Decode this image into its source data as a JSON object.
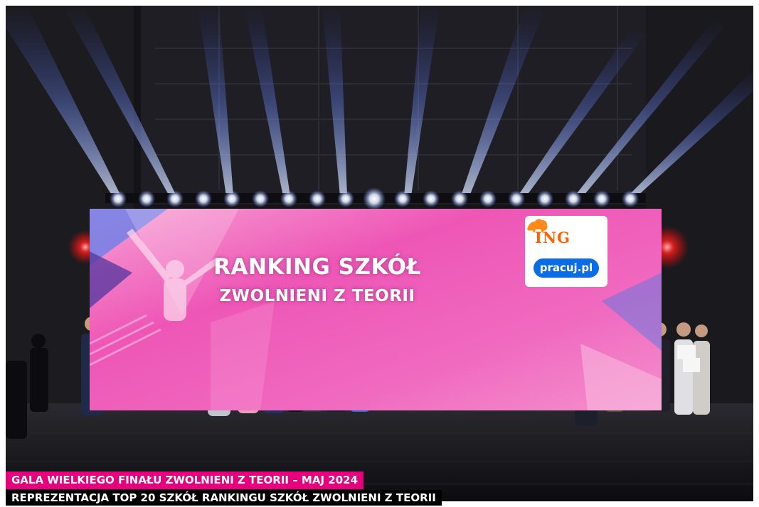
{
  "screen": {
    "title_line1": "RANKING SZKÓŁ",
    "title_line2": "ZWOLNIENI Z TEORII",
    "logo_ing": "ING",
    "logo_pracuj": "pracuj.pl"
  },
  "captions": {
    "event": "GALA WIELKIEGO FINAŁU ZWOLNIENI Z TEORII – MAJ 2024",
    "description": "REPREZENTACJA TOP 20 SZKÓŁ RANKINGU SZKÓŁ ZWOLNIENI Z TEORII"
  },
  "colors": {
    "caption_accent": "#e6007e",
    "screen_pink": "#f062c0",
    "ing_orange": "#ff6200",
    "pracuj_blue": "#0a6de6"
  }
}
